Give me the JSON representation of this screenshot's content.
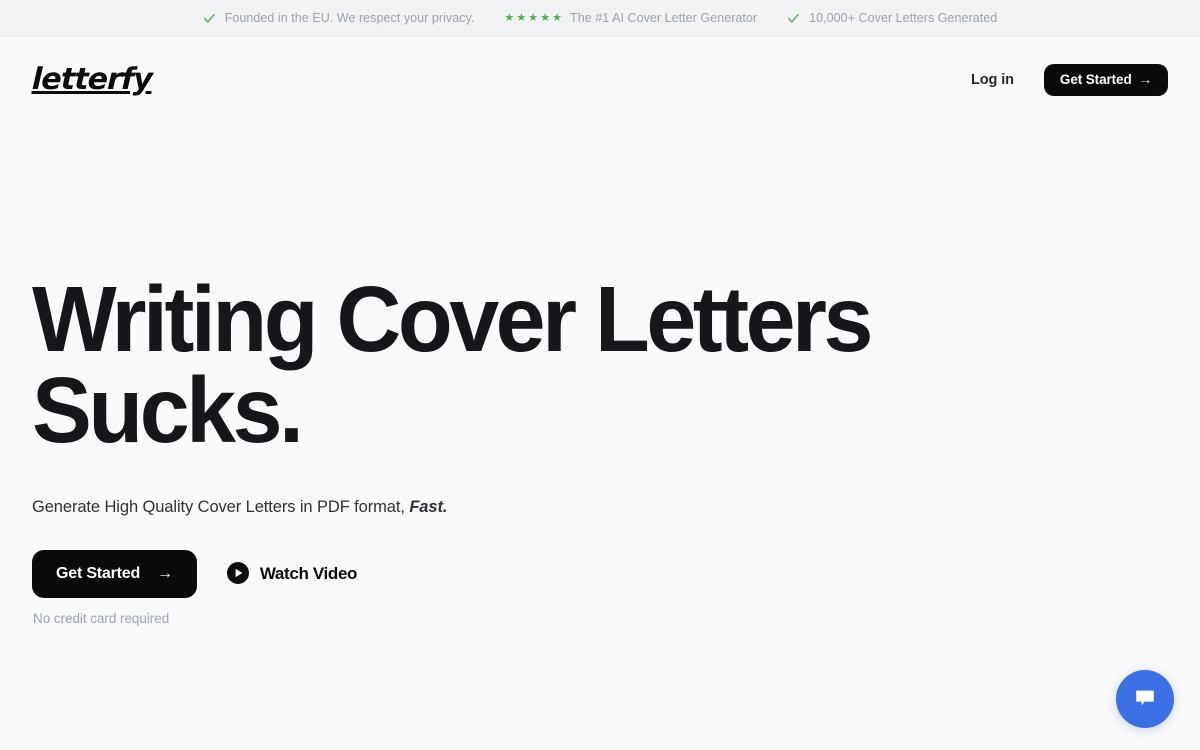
{
  "announcement": {
    "items": [
      {
        "icon": "check-icon",
        "text": "Founded in the EU. We respect your privacy."
      },
      {
        "icon": "stars-icon",
        "rating": 5,
        "text": "The #1 AI Cover Letter Generator"
      },
      {
        "icon": "check-icon",
        "text": "10,000+ Cover Letters Generated"
      }
    ]
  },
  "header": {
    "logo": "letterfy",
    "login_label": "Log in",
    "cta_label": "Get Started",
    "cta_arrow": "→"
  },
  "hero": {
    "headline_line1": "Writing Cover Letters",
    "headline_line2": "Sucks.",
    "subhead_text": "Generate High Quality Cover Letters in PDF format,",
    "subhead_accent": "Fast.",
    "cta_label": "Get Started",
    "cta_arrow": "→",
    "watch_video_label": "Watch Video",
    "fineprint": "No credit card required"
  },
  "chat": {
    "label": "chat-bubble-icon"
  },
  "colors": {
    "page_background": "#f9fafb",
    "banner_background": "#f1f2f4",
    "accent_green": "#4caf50",
    "button_black": "#0a0a0a",
    "chat_blue": "#3d6fe5",
    "muted_text": "#9ca3af"
  }
}
